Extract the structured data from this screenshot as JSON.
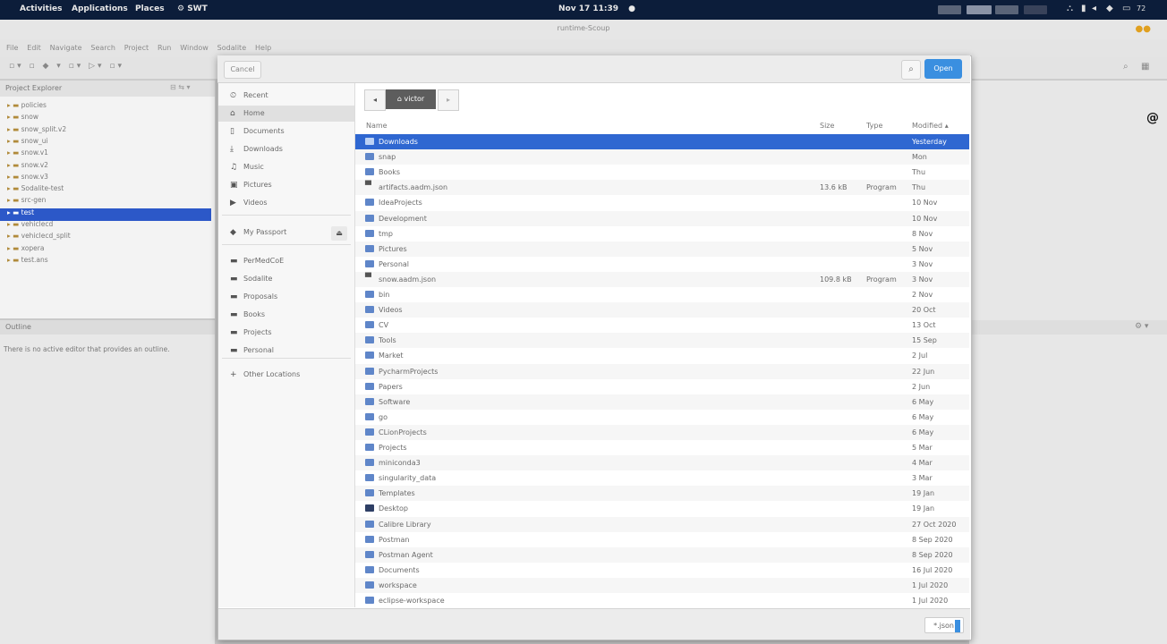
{
  "topbar": {
    "activities": "Activities",
    "applications": "Applications",
    "places": "Places",
    "app": "SWT",
    "clock": "Nov 17 11:39",
    "battery": "72"
  },
  "eclipse": {
    "window_title": "runtime-Scoup",
    "menu": [
      "File",
      "Edit",
      "Navigate",
      "Search",
      "Project",
      "Run",
      "Window",
      "Sodalite",
      "Help"
    ],
    "project_explorer_title": "Project Explorer",
    "tree": [
      "policies",
      "snow",
      "snow_split.v2",
      "snow_ui",
      "snow.v1",
      "snow.v2",
      "snow.v3",
      "Sodalite-test",
      "src-gen",
      "test",
      "vehiclecd",
      "vehiclecd_split",
      "xopera",
      "test.ans"
    ],
    "selected_tree_index": 9,
    "outline_title": "Outline",
    "outline_message": "There is no active editor that provides an outline.",
    "at_symbol": "@"
  },
  "dialog": {
    "cancel_label": "Cancel",
    "open_label": "Open",
    "path_current": "victor",
    "places": [
      {
        "icon": "clock-icon",
        "glyph": "⏲",
        "label": "Recent"
      },
      {
        "icon": "home-icon",
        "glyph": "⌂",
        "label": "Home",
        "selected": true
      },
      {
        "icon": "documents-icon",
        "glyph": "▯",
        "label": "Documents"
      },
      {
        "icon": "download-icon",
        "glyph": "⤓",
        "label": "Downloads"
      },
      {
        "icon": "music-icon",
        "glyph": "♫",
        "label": "Music"
      },
      {
        "icon": "pictures-icon",
        "glyph": "▣",
        "label": "Pictures"
      },
      {
        "icon": "videos-icon",
        "glyph": "▶",
        "label": "Videos"
      },
      {
        "icon": "drive-icon",
        "glyph": "◆",
        "label": "My Passport",
        "eject": true
      },
      {
        "icon": "folder-icon",
        "glyph": "▬",
        "label": "PerMedCoE"
      },
      {
        "icon": "folder-icon",
        "glyph": "▬",
        "label": "Sodalite"
      },
      {
        "icon": "folder-icon",
        "glyph": "▬",
        "label": "Proposals"
      },
      {
        "icon": "folder-icon",
        "glyph": "▬",
        "label": "Books"
      },
      {
        "icon": "folder-icon",
        "glyph": "▬",
        "label": "Projects"
      },
      {
        "icon": "folder-icon",
        "glyph": "▬",
        "label": "Personal"
      },
      {
        "icon": "plus-icon",
        "glyph": "+",
        "label": "Other Locations"
      }
    ],
    "columns": {
      "name": "Name",
      "size": "Size",
      "type": "Type",
      "modified": "Modified"
    },
    "files": [
      {
        "name": "Downloads",
        "size": "",
        "type": "",
        "modified": "Yesterday",
        "kind": "folder",
        "selected": true
      },
      {
        "name": "snap",
        "size": "",
        "type": "",
        "modified": "Mon",
        "kind": "folder"
      },
      {
        "name": "Books",
        "size": "",
        "type": "",
        "modified": "Thu",
        "kind": "folder"
      },
      {
        "name": "artifacts.aadm.json",
        "size": "13.6 kB",
        "type": "Program",
        "modified": "Thu",
        "kind": "file"
      },
      {
        "name": "IdeaProjects",
        "size": "",
        "type": "",
        "modified": "10 Nov",
        "kind": "folder"
      },
      {
        "name": "Development",
        "size": "",
        "type": "",
        "modified": "10 Nov",
        "kind": "folder"
      },
      {
        "name": "tmp",
        "size": "",
        "type": "",
        "modified": "8 Nov",
        "kind": "folder"
      },
      {
        "name": "Pictures",
        "size": "",
        "type": "",
        "modified": "5 Nov",
        "kind": "folder"
      },
      {
        "name": "Personal",
        "size": "",
        "type": "",
        "modified": "3 Nov",
        "kind": "folder"
      },
      {
        "name": "snow.aadm.json",
        "size": "109.8 kB",
        "type": "Program",
        "modified": "3 Nov",
        "kind": "file"
      },
      {
        "name": "bin",
        "size": "",
        "type": "",
        "modified": "2 Nov",
        "kind": "folder"
      },
      {
        "name": "Videos",
        "size": "",
        "type": "",
        "modified": "20 Oct",
        "kind": "folder"
      },
      {
        "name": "CV",
        "size": "",
        "type": "",
        "modified": "13 Oct",
        "kind": "folder"
      },
      {
        "name": "Tools",
        "size": "",
        "type": "",
        "modified": "15 Sep",
        "kind": "folder"
      },
      {
        "name": "Market",
        "size": "",
        "type": "",
        "modified": "2 Jul",
        "kind": "folder"
      },
      {
        "name": "PycharmProjects",
        "size": "",
        "type": "",
        "modified": "22 Jun",
        "kind": "folder"
      },
      {
        "name": "Papers",
        "size": "",
        "type": "",
        "modified": "2 Jun",
        "kind": "folder"
      },
      {
        "name": "Software",
        "size": "",
        "type": "",
        "modified": "6 May",
        "kind": "folder"
      },
      {
        "name": "go",
        "size": "",
        "type": "",
        "modified": "6 May",
        "kind": "folder"
      },
      {
        "name": "CLionProjects",
        "size": "",
        "type": "",
        "modified": "6 May",
        "kind": "folder"
      },
      {
        "name": "Projects",
        "size": "",
        "type": "",
        "modified": "5 Mar",
        "kind": "folder"
      },
      {
        "name": "miniconda3",
        "size": "",
        "type": "",
        "modified": "4 Mar",
        "kind": "folder"
      },
      {
        "name": "singularity_data",
        "size": "",
        "type": "",
        "modified": "3 Mar",
        "kind": "folder"
      },
      {
        "name": "Templates",
        "size": "",
        "type": "",
        "modified": "19 Jan",
        "kind": "folder"
      },
      {
        "name": "Desktop",
        "size": "",
        "type": "",
        "modified": "19 Jan",
        "kind": "desktop"
      },
      {
        "name": "Calibre Library",
        "size": "",
        "type": "",
        "modified": "27 Oct 2020",
        "kind": "folder"
      },
      {
        "name": "Postman",
        "size": "",
        "type": "",
        "modified": "8 Sep 2020",
        "kind": "folder"
      },
      {
        "name": "Postman Agent",
        "size": "",
        "type": "",
        "modified": "8 Sep 2020",
        "kind": "folder"
      },
      {
        "name": "Documents",
        "size": "",
        "type": "",
        "modified": "16 Jul 2020",
        "kind": "folder"
      },
      {
        "name": "workspace",
        "size": "",
        "type": "",
        "modified": "1 Jul 2020",
        "kind": "folder"
      },
      {
        "name": "eclipse-workspace",
        "size": "",
        "type": "",
        "modified": "1 Jul 2020",
        "kind": "folder"
      }
    ],
    "filter_label": "*.json"
  }
}
